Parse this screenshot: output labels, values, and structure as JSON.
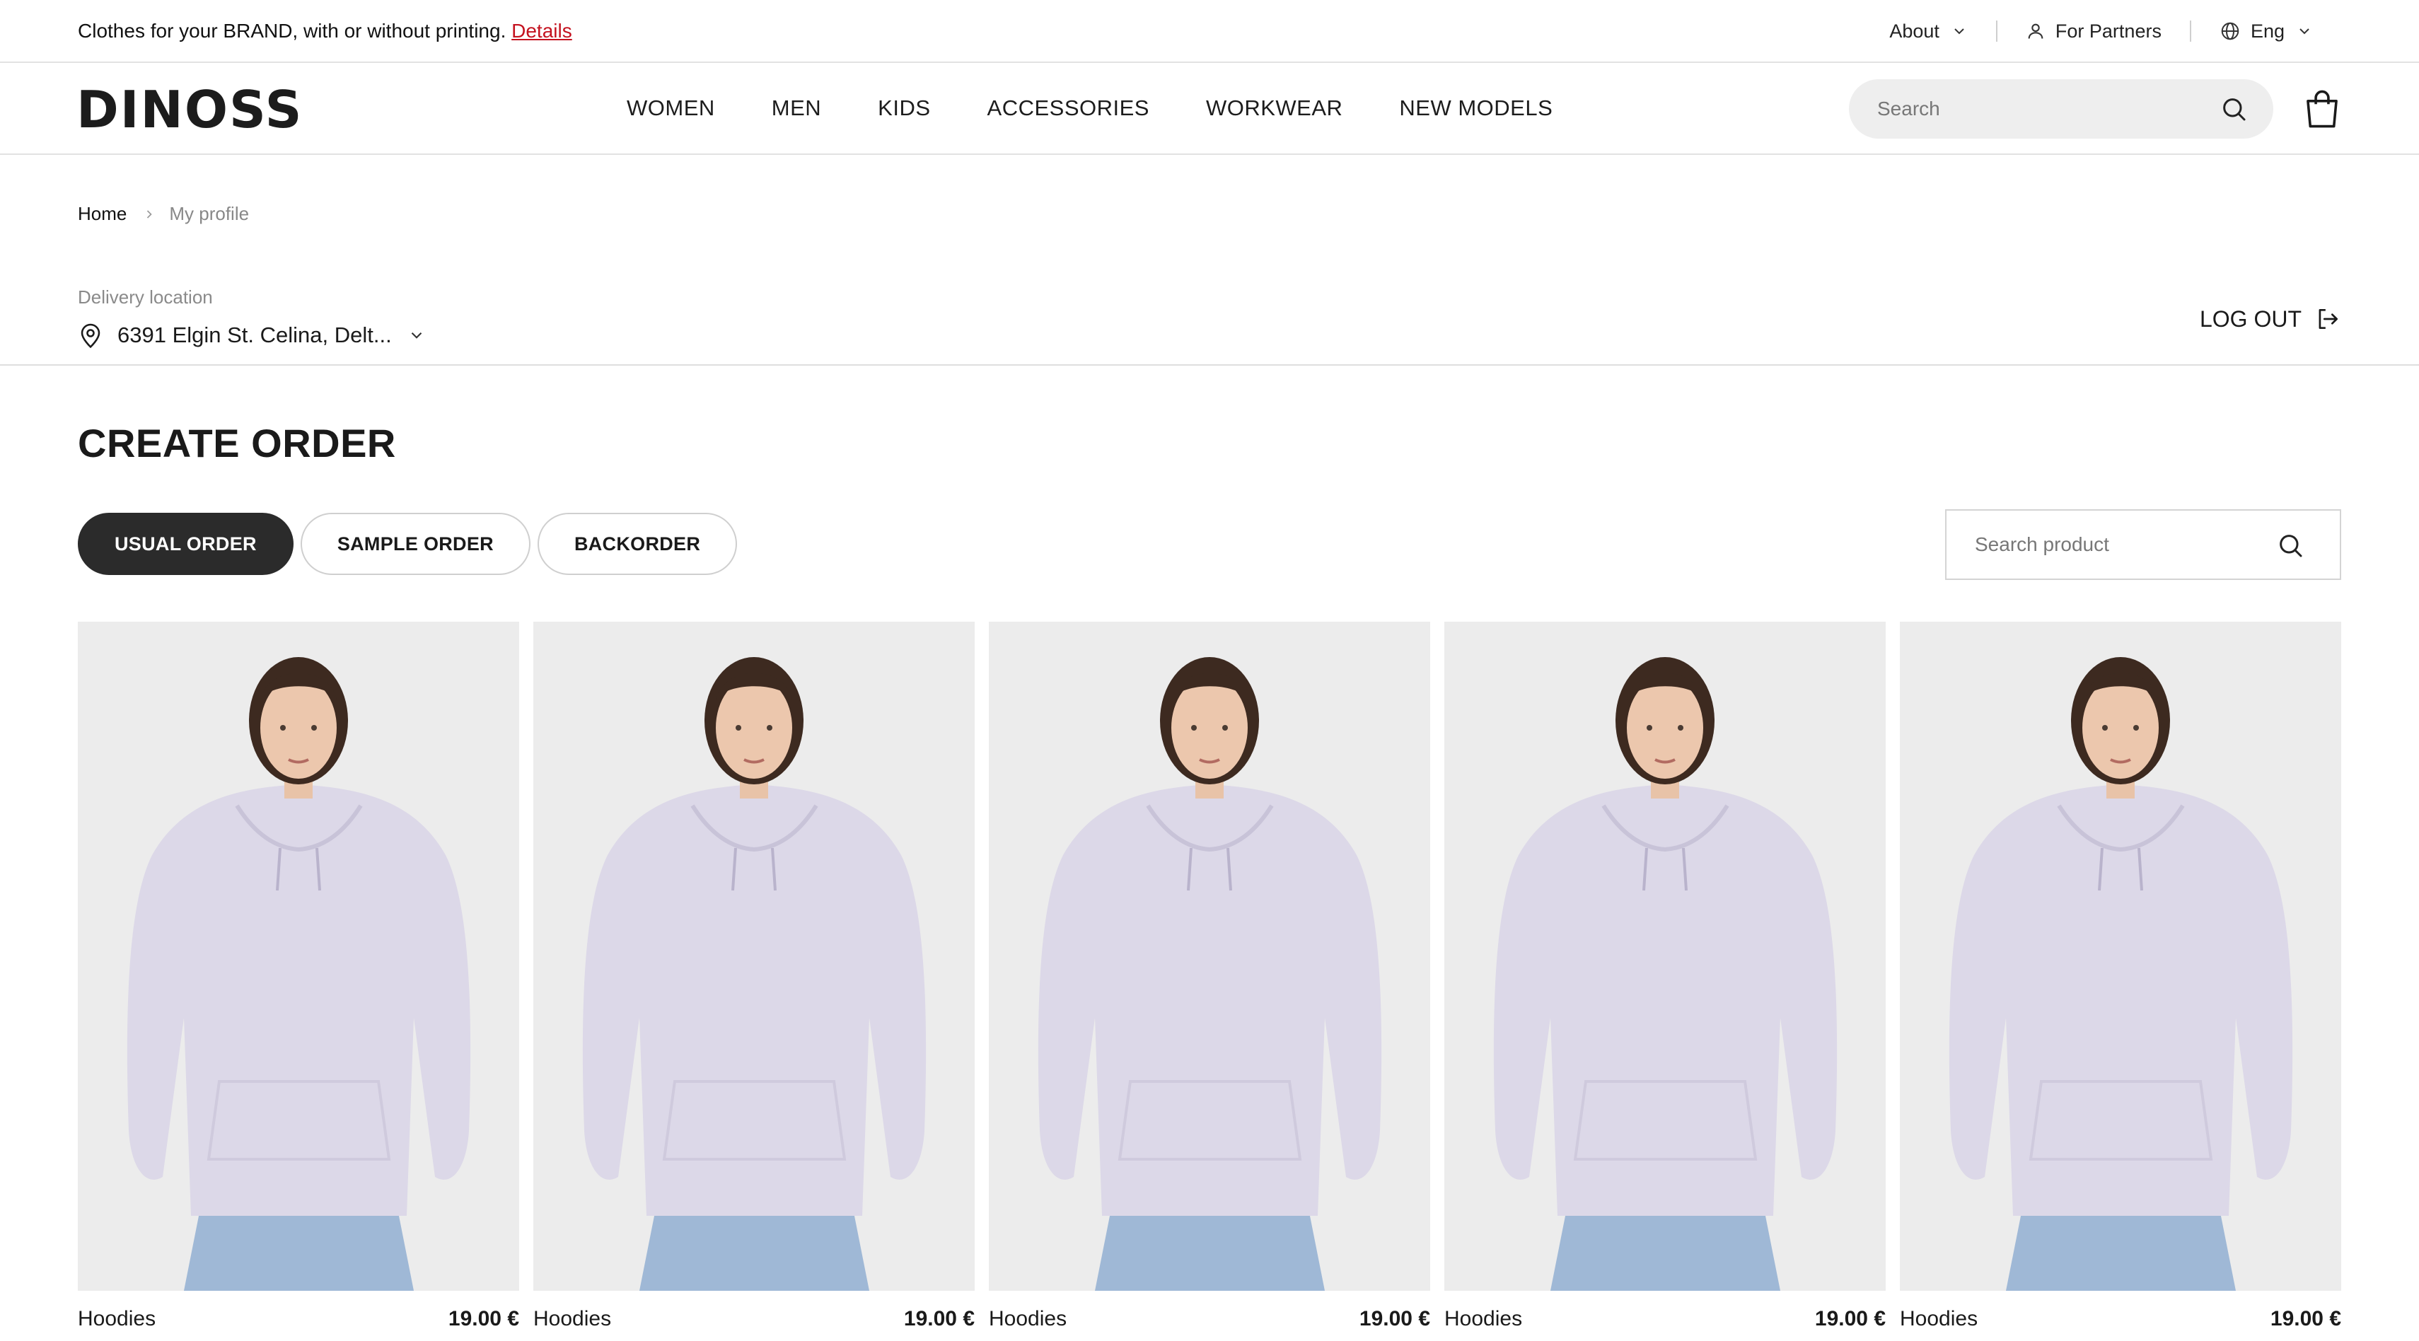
{
  "announcement": {
    "text": "Clothes for your BRAND, with or without printing.",
    "link": "Details"
  },
  "topbar": {
    "about": "About",
    "partners": "For Partners",
    "language": "Eng"
  },
  "header": {
    "logo": "DINOSS",
    "nav": [
      "WOMEN",
      "MEN",
      "KIDS",
      "ACCESSORIES",
      "WORKWEAR",
      "NEW MODELS"
    ],
    "search_placeholder": "Search"
  },
  "breadcrumb": {
    "home": "Home",
    "current": "My profile"
  },
  "delivery": {
    "label": "Delivery location",
    "address": "6391 Elgin St. Celina, Delt..."
  },
  "logout_label": "LOG OUT",
  "page_title": "CREATE ORDER",
  "order_tabs": [
    {
      "label": "USUAL ORDER",
      "active": true
    },
    {
      "label": "SAMPLE ORDER",
      "active": false
    },
    {
      "label": "BACKORDER",
      "active": false
    }
  ],
  "product_search_placeholder": "Search product",
  "products": [
    {
      "name": "Hoodies",
      "price": "19.00 €"
    },
    {
      "name": "Hoodies",
      "price": "19.00 €"
    },
    {
      "name": "Hoodies",
      "price": "19.00 €"
    },
    {
      "name": "Hoodies",
      "price": "19.00 €"
    },
    {
      "name": "Hoodies",
      "price": "19.00 €"
    }
  ],
  "colors": {
    "accent_link": "#c4121f",
    "active_tab": "#2b2b2b",
    "hoodie": "#dcd8e8",
    "jeans": "#9fb8d6"
  }
}
